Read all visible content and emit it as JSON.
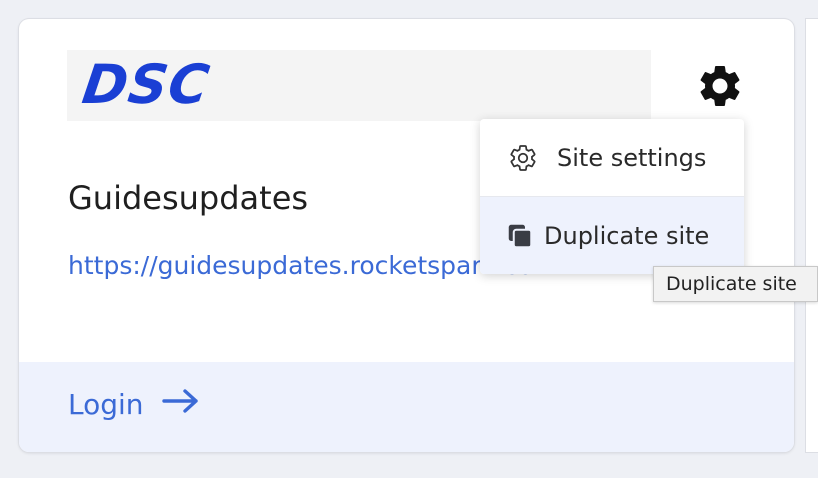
{
  "card": {
    "logo_text": "DSC",
    "site_title": "Guidesupdates",
    "site_url": "https://guidesupdates.rocketspark.co.nz",
    "login_label": "Login",
    "settings_icon": "gear-icon"
  },
  "menu": {
    "items": [
      {
        "label": "Site settings",
        "icon": "gear-outline-icon"
      },
      {
        "label": "Duplicate site",
        "icon": "copy-icon"
      }
    ]
  },
  "tooltip": {
    "text": "Duplicate site"
  },
  "colors": {
    "accent": "#3b6ad6",
    "logo_blue": "#1a3fd4",
    "footer_bg": "#eef2fd",
    "page_bg": "#eef0f5"
  }
}
